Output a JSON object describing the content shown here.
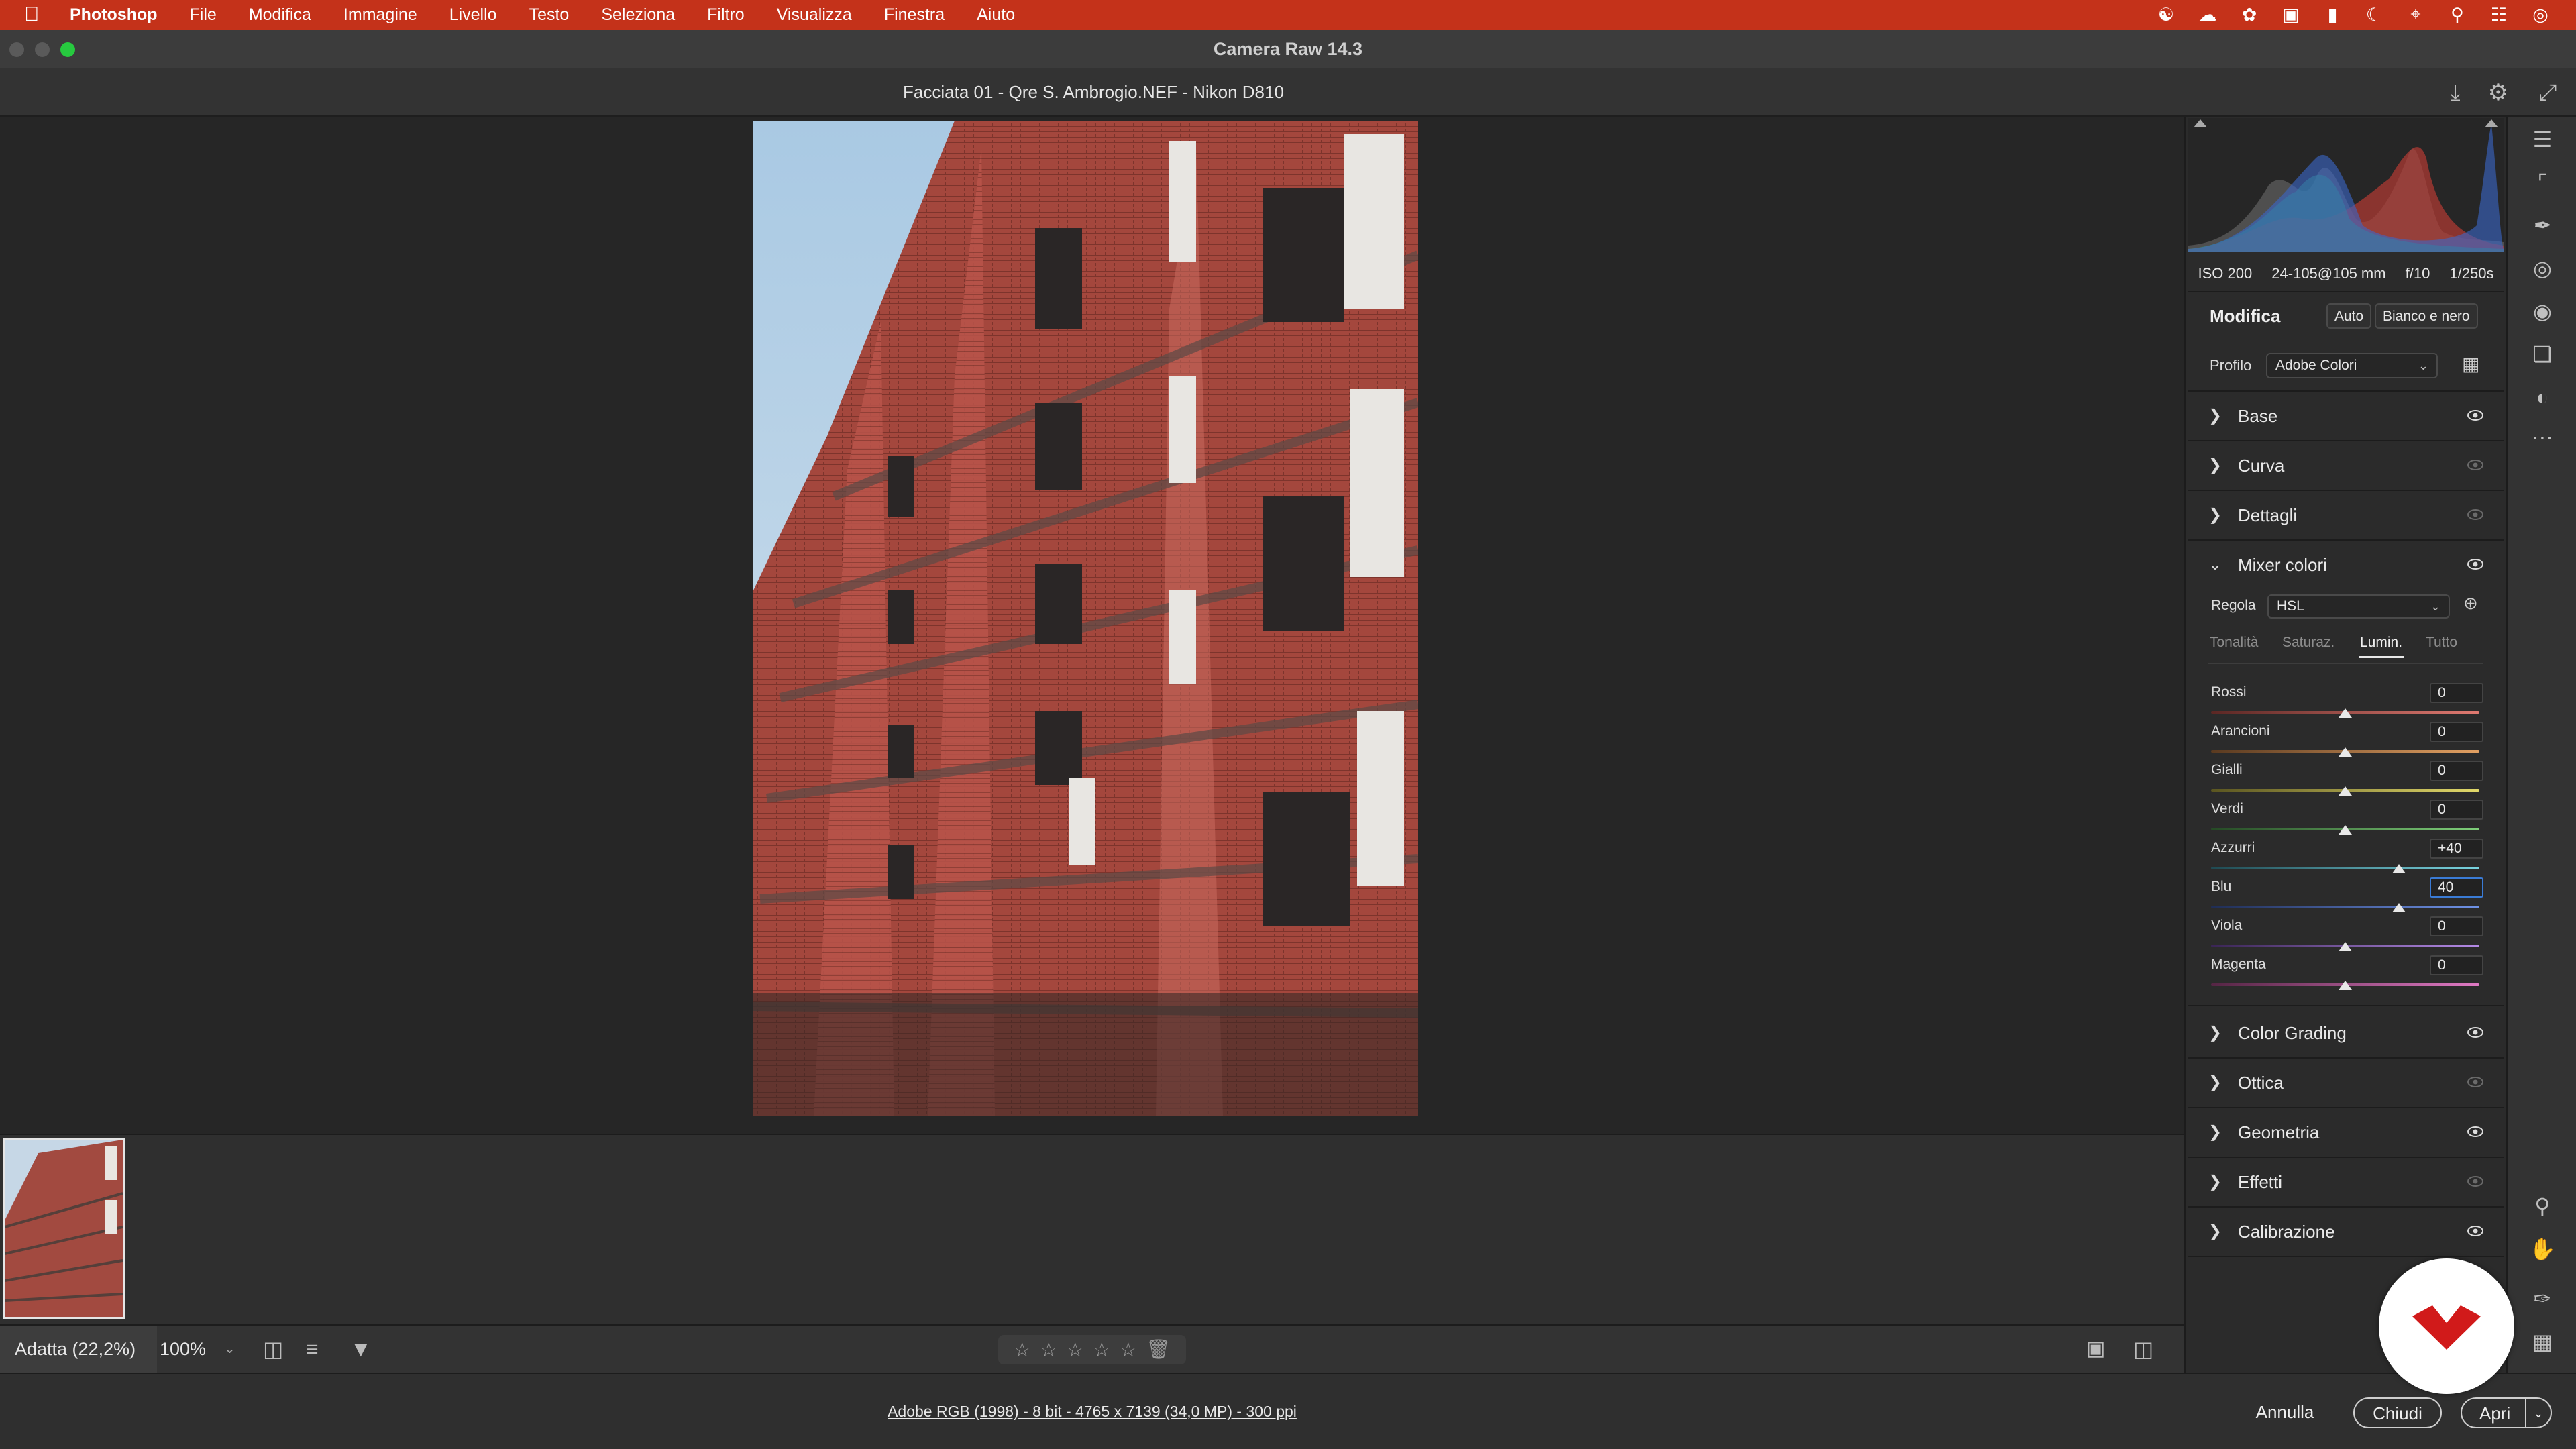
{
  "menubar": {
    "app": "Photoshop",
    "items": [
      "File",
      "Modifica",
      "Immagine",
      "Livello",
      "Testo",
      "Seleziona",
      "Filtro",
      "Visualizza",
      "Finestra",
      "Aiuto"
    ]
  },
  "window": {
    "title": "Camera Raw 14.3",
    "document_title": "Facciata 01 - Qre S. Ambrogio.NEF  -  Nikon D810"
  },
  "exif": {
    "iso": "ISO 200",
    "lens": "24-105@105 mm",
    "aperture": "f/10",
    "shutter": "1/250s"
  },
  "edit": {
    "heading": "Modifica",
    "auto_label": "Auto",
    "bw_label": "Bianco e nero",
    "profile_label": "Profilo",
    "profile_value": "Adobe Colori"
  },
  "sections_top": [
    "Base",
    "Curva",
    "Dettagli"
  ],
  "mixer": {
    "title": "Mixer colori",
    "adjust_label": "Regola",
    "adjust_value": "HSL",
    "tabs": [
      "Tonalità",
      "Saturaz.",
      "Lumin.",
      "Tutto"
    ],
    "active_tab": "Lumin.",
    "sliders": [
      {
        "name": "Rossi",
        "value": "0",
        "num": 0
      },
      {
        "name": "Arancioni",
        "value": "0",
        "num": 0
      },
      {
        "name": "Gialli",
        "value": "0",
        "num": 0
      },
      {
        "name": "Verdi",
        "value": "0",
        "num": 0
      },
      {
        "name": "Azzurri",
        "value": "+40",
        "num": 40
      },
      {
        "name": "Blu",
        "value": "40",
        "num": 40
      },
      {
        "name": "Viola",
        "value": "0",
        "num": 0
      },
      {
        "name": "Magenta",
        "value": "0",
        "num": 0
      }
    ]
  },
  "sections_bottom": [
    "Color Grading",
    "Ottica",
    "Geometria",
    "Effetti",
    "Calibrazione"
  ],
  "bottombar": {
    "fit_label": "Adatta (22,2%)",
    "zoom_label": "100%"
  },
  "footer": {
    "info": "Adobe RGB (1998) - 8 bit - 4765 x 7139 (34,0 MP) - 300 ppi",
    "cancel": "Annulla",
    "close": "Chiudi",
    "open": "Apri"
  },
  "colors": {
    "menubar": "#c4321a",
    "accent": "#3a7bd5",
    "brand": "#d11a1a"
  }
}
